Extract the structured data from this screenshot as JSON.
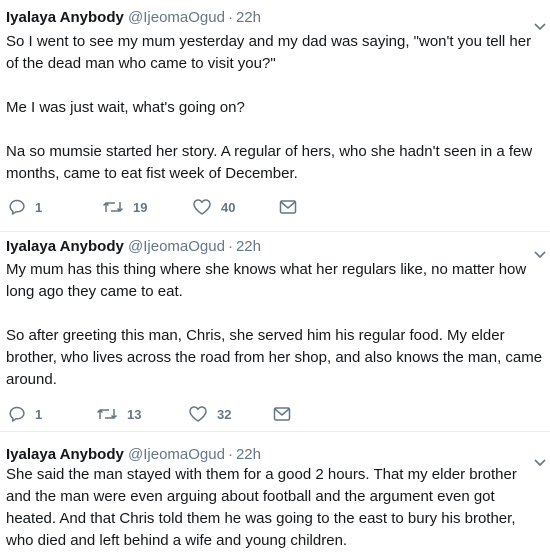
{
  "tweets": [
    {
      "name": "Iyalaya Anybody",
      "handle": "@IjeomaOgud",
      "separator": "·",
      "time": "22h",
      "paragraphs": [
        "So I went to see my mum yesterday and my dad was saying, \"won't you tell her of the dead man who came to visit you?\"",
        "Me I was just wait, what's going on?",
        "Na so mumsie started her story. A regular of hers, who she hadn't seen in a few months, came to eat fist week of December."
      ],
      "replies": "1",
      "retweets": "19",
      "likes": "40"
    },
    {
      "name": "Iyalaya Anybody",
      "handle": "@IjeomaOgud",
      "separator": "·",
      "time": "22h",
      "paragraphs": [
        "My mum has this thing where she knows what her regulars like, no matter how long ago they came to eat.",
        "So after greeting this man, Chris, she served him his regular food. My elder brother, who lives across the road from her shop, and also knows the man, came around."
      ],
      "replies": "1",
      "retweets": "13",
      "likes": "32"
    },
    {
      "name": "Iyalaya Anybody",
      "handle": "@IjeomaOgud",
      "separator": "·",
      "time": "22h",
      "paragraphs": [
        "She said the man stayed with them for a good 2 hours. That my elder brother and the man were even arguing about football and the argument even got heated. And that Chris told them he was going to the east to bury his brother, who died and left behind a wife and young children."
      ]
    }
  ],
  "icons": {
    "reply": "reply-icon",
    "retweet": "retweet-icon",
    "like": "heart-icon",
    "message": "envelope-icon",
    "caret": "chevron-down-icon"
  },
  "colors": {
    "text": "#14171a",
    "secondary": "#657786",
    "divider": "#e6ecf0"
  }
}
